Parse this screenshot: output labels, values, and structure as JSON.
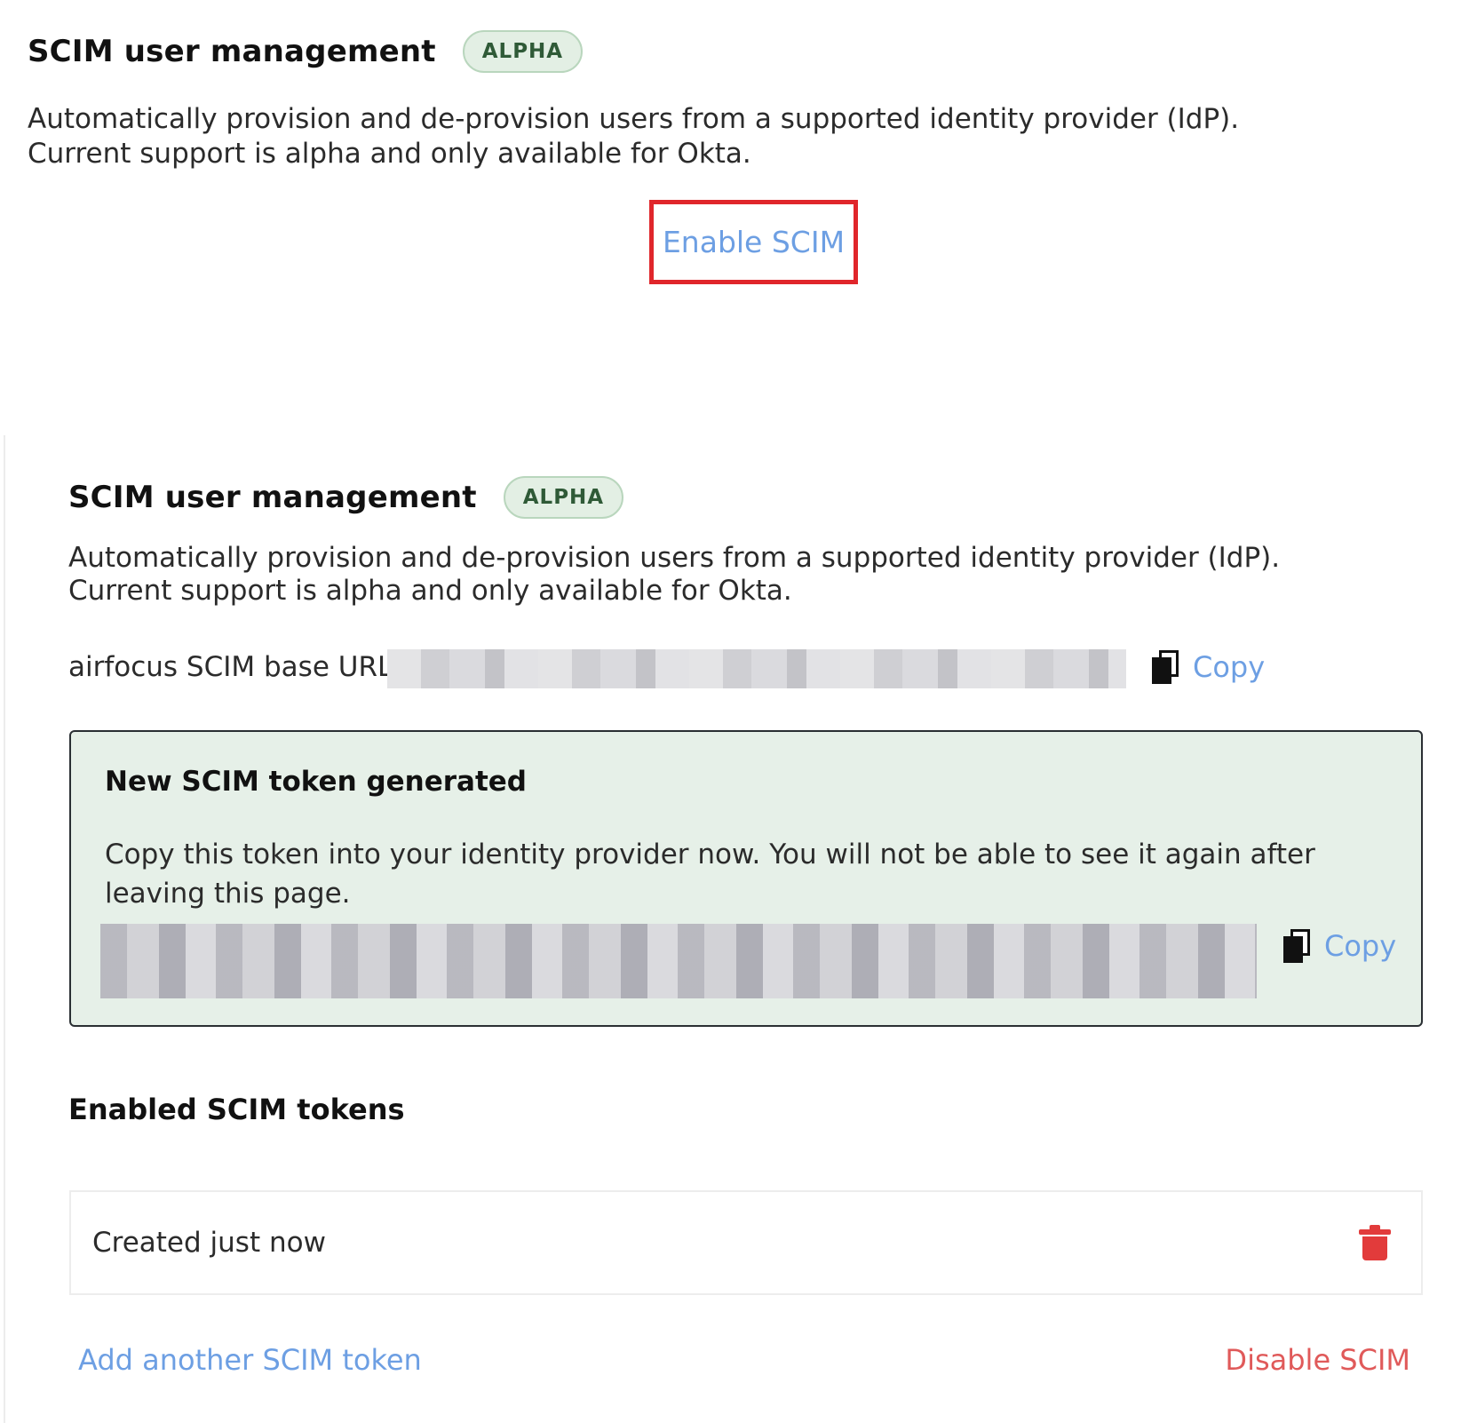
{
  "top_panel": {
    "title": "SCIM user management",
    "badge": "ALPHA",
    "description_line1": "Automatically provision and de-provision users from a supported identity provider (IdP).",
    "description_line2": "Current support is alpha and only available for Okta.",
    "enable_button": "Enable SCIM"
  },
  "enabled_panel": {
    "title": "SCIM user management",
    "badge": "ALPHA",
    "description_line1": "Automatically provision and de-provision users from a supported identity provider (IdP).",
    "description_line2": "Current support is alpha and only available for Okta.",
    "base_url_label": "airfocus SCIM base URL:",
    "copy_label": "Copy",
    "new_token": {
      "title": "New SCIM token generated",
      "description": "Copy this token into your identity provider now. You will not be able to see it again after leaving this page.",
      "copy_label": "Copy"
    },
    "tokens_section_title": "Enabled SCIM tokens",
    "tokens": [
      {
        "label": "Created just now"
      }
    ],
    "add_token_label": "Add another SCIM token",
    "disable_label": "Disable SCIM"
  },
  "colors": {
    "link": "#6d9fe3",
    "danger": "#e05a5a",
    "highlight_border": "#e0262b",
    "badge_bg": "#e3efe4",
    "success_bg": "#e6f0e8"
  }
}
